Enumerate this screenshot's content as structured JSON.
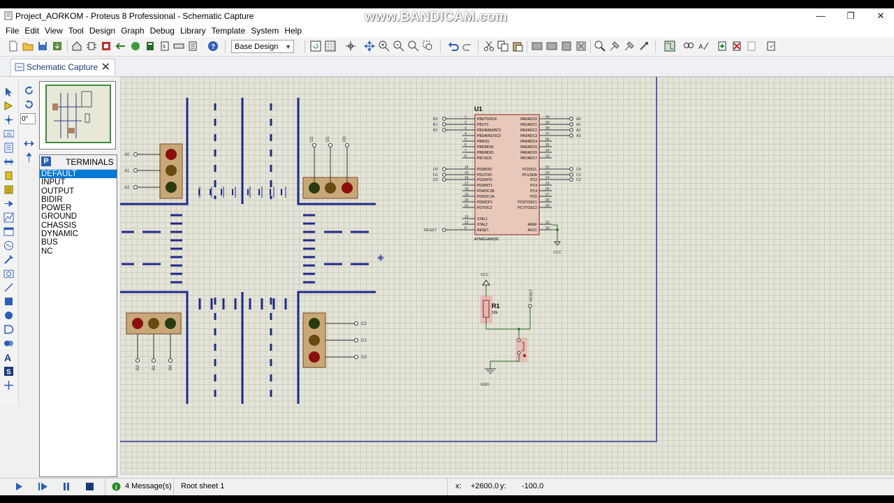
{
  "window": {
    "title": "Project_AORKOM - Proteus 8 Professional - Schematic Capture",
    "watermark": "www.BANDICAM.com",
    "controls": {
      "minimize": "—",
      "restore": "❐",
      "close": "✕"
    }
  },
  "menu": [
    "File",
    "Edit",
    "View",
    "Tool",
    "Design",
    "Graph",
    "Debug",
    "Library",
    "Template",
    "System",
    "Help"
  ],
  "toolbar": {
    "design_combo": "Base Design"
  },
  "tab": {
    "label": "Schematic Capture",
    "close": "✕"
  },
  "rotation": {
    "value": "0°"
  },
  "selector": {
    "mode": "P",
    "title": "TERMINALS",
    "items": [
      "DEFAULT",
      "INPUT",
      "OUTPUT",
      "BIDIR",
      "POWER",
      "GROUND",
      "CHASSIS",
      "DYNAMIC",
      "BUS",
      "NC"
    ],
    "selected": "DEFAULT"
  },
  "schematic": {
    "mcu": {
      "ref": "U1",
      "part": "ATMEGA8535",
      "left_pins": [
        "PB0/T0/XCK",
        "PB1/T1",
        "PB2/AIN0/INT2",
        "PB3/AIN1/OC0",
        "PB4/SS",
        "PB5/MOSI",
        "PB6/MISO",
        "PB7/SCK",
        "PD0/RXD",
        "PD1/TXD",
        "PD2/INT0",
        "PD3/INT1",
        "PD4/OC1B",
        "PD5/OC1A",
        "PD6/ICP1",
        "PD7/OC2",
        "XTAL1",
        "XTAL2",
        "RESET"
      ],
      "left_nums": [
        "1",
        "2",
        "3",
        "4",
        "5",
        "6",
        "7",
        "8",
        "14",
        "15",
        "16",
        "17",
        "18",
        "19",
        "20",
        "21",
        "13",
        "12",
        "9"
      ],
      "right_pins": [
        "PA0/ADC0",
        "PA1/ADC1",
        "PA2/ADC2",
        "PA3/ADC3",
        "PA4/ADC4",
        "PA5/ADC5",
        "PA6/ADC6",
        "PA7/ADC7",
        "PC0/SCL",
        "PC1/SDA",
        "PC2",
        "PC3",
        "PC4",
        "PC5",
        "PC6/TOSC1",
        "PC7/TOSC2",
        "AREF",
        "AVCC"
      ],
      "right_nums": [
        "40",
        "39",
        "38",
        "37",
        "36",
        "35",
        "34",
        "33",
        "22",
        "23",
        "24",
        "25",
        "26",
        "27",
        "28",
        "29",
        "32",
        "30"
      ],
      "b_terms": [
        "B0",
        "B1",
        "B2"
      ],
      "d_terms": [
        "D0",
        "D1",
        "D2"
      ],
      "a_terms": [
        "A0",
        "A1",
        "A2",
        "A3"
      ],
      "c_terms": [
        "C0",
        "C1",
        "C2"
      ],
      "reset_term": "RESET",
      "vcc": "VCC"
    },
    "reset_circuit": {
      "vcc": "VCC",
      "resistor_ref": "R1",
      "resistor_value": "10k",
      "reset_label": "RESET",
      "gnd": "GND"
    },
    "traffic_lights": {
      "west": [
        "A0",
        "A1",
        "A2"
      ],
      "north": [
        "D2",
        "D1",
        "D0"
      ],
      "southwest": [
        "B2",
        "B1",
        "B0"
      ],
      "east": [
        "C2",
        "C1",
        "C0"
      ]
    }
  },
  "status": {
    "messages": "4 Message(s)",
    "sheet": "Root sheet 1",
    "x_label": "x:",
    "x_value": "+2600.0",
    "y_label": "y:",
    "y_value": "-100.0"
  }
}
